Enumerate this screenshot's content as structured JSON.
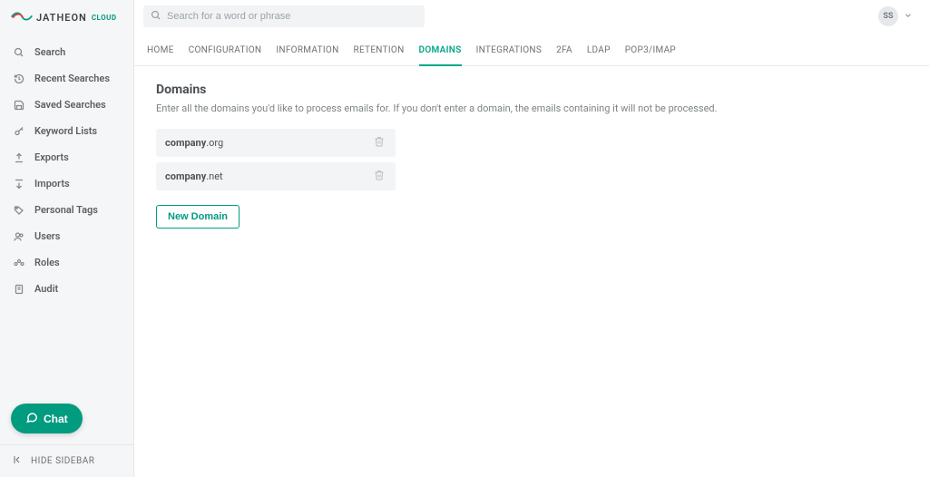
{
  "brand": {
    "name": "JATHEON",
    "suffix": "CLOUD"
  },
  "search": {
    "placeholder": "Search for a word or phrase"
  },
  "user": {
    "initials": "SS"
  },
  "sidebar": {
    "items": [
      {
        "label": "Search"
      },
      {
        "label": "Recent Searches"
      },
      {
        "label": "Saved Searches"
      },
      {
        "label": "Keyword Lists"
      },
      {
        "label": "Exports"
      },
      {
        "label": "Imports"
      },
      {
        "label": "Personal Tags"
      },
      {
        "label": "Users"
      },
      {
        "label": "Roles"
      },
      {
        "label": "Audit"
      }
    ],
    "hide": "HIDE SIDEBAR"
  },
  "tabs": [
    {
      "label": "HOME"
    },
    {
      "label": "CONFIGURATION"
    },
    {
      "label": "INFORMATION"
    },
    {
      "label": "RETENTION"
    },
    {
      "label": "DOMAINS",
      "active": true
    },
    {
      "label": "INTEGRATIONS"
    },
    {
      "label": "2FA"
    },
    {
      "label": "LDAP"
    },
    {
      "label": "POP3/IMAP"
    }
  ],
  "page": {
    "title": "Domains",
    "description": "Enter all the domains you'd like to process emails for. If you don't enter a domain, the emails containing it will not be processed."
  },
  "domains": [
    {
      "bold": "company",
      "rest": ".org"
    },
    {
      "bold": "company",
      "rest": ".net"
    }
  ],
  "actions": {
    "newDomain": "New Domain"
  },
  "chat": {
    "label": "Chat"
  }
}
